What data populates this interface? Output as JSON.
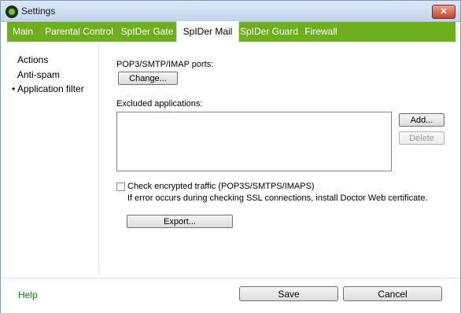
{
  "window": {
    "title": "Settings",
    "close_label": "✕"
  },
  "tabs": [
    {
      "label": "Main"
    },
    {
      "label": "Parental Control"
    },
    {
      "label": "SpIDer Gate"
    },
    {
      "label": "SpIDer Mail",
      "active": true
    },
    {
      "label": "SpIDer Guard"
    },
    {
      "label": "Firewall"
    }
  ],
  "sidebar": {
    "items": [
      {
        "label": "Actions"
      },
      {
        "label": "Anti-spam"
      },
      {
        "label": "Application filter",
        "selected": true
      }
    ],
    "bullet": "•"
  },
  "main": {
    "ports_label": "POP3/SMTP/IMAP ports:",
    "change_button": "Change...",
    "excluded_label": "Excluded applications:",
    "add_button": "Add...",
    "delete_button": "Delete",
    "check_encrypted_label": "Check encrypted traffic (POP3S/SMTPS/IMAPS)",
    "ssl_note": "If error occurs during checking SSL connections, install Doctor Web certificate.",
    "export_button": "Export..."
  },
  "footer": {
    "help_label": "Help",
    "save_button": "Save",
    "cancel_button": "Cancel"
  },
  "colors": {
    "tab_bar": "#6eaf1d",
    "help_link": "#1f7a1f"
  }
}
